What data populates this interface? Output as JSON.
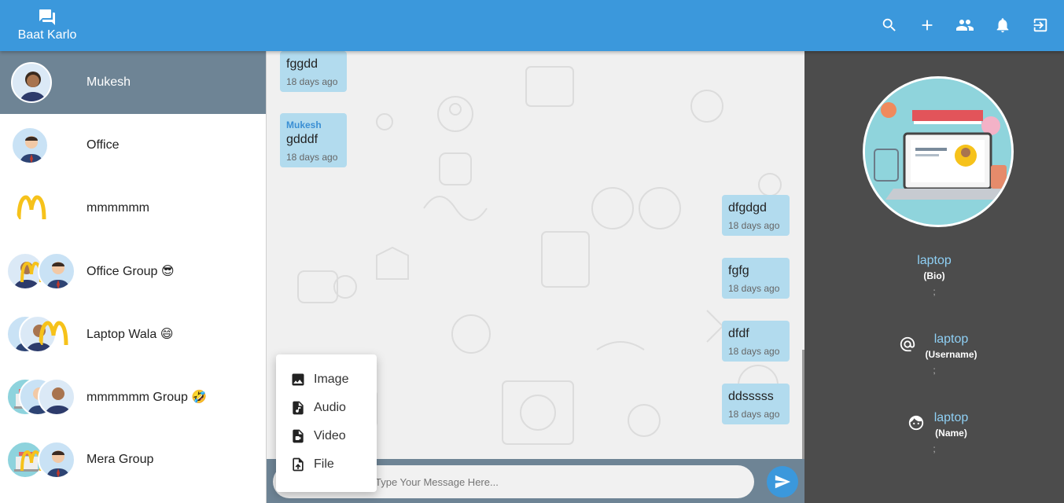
{
  "app": {
    "name": "Baat Karlo"
  },
  "topbar": {
    "icons": [
      "search-icon",
      "add-icon",
      "people-icon",
      "bell-icon",
      "logout-icon"
    ]
  },
  "sidebar": {
    "items": [
      {
        "label": "Mukesh",
        "active": true
      },
      {
        "label": "Office"
      },
      {
        "label": "mmmmmm"
      },
      {
        "label": "Office Group 😎"
      },
      {
        "label": "Laptop Wala 😄"
      },
      {
        "label": "mmmmmm Group 🤣"
      },
      {
        "label": "Mera Group"
      }
    ]
  },
  "chat": {
    "messages": [
      {
        "side": "left",
        "text": "fggdd",
        "time": "18 days ago"
      },
      {
        "side": "left",
        "sender": "Mukesh",
        "text": "gdddf",
        "time": "18 days ago"
      },
      {
        "side": "right",
        "text": "dfgdgd",
        "time": "18 days ago"
      },
      {
        "side": "right",
        "text": "fgfg",
        "time": "18 days ago"
      },
      {
        "side": "right",
        "text": "dfdf",
        "time": "18 days ago"
      },
      {
        "side": "right",
        "text": "ddsssss",
        "time": "18 days ago"
      }
    ],
    "input": {
      "placeholder": "Type Your Message Here..."
    }
  },
  "attach_menu": {
    "items": [
      {
        "label": "Image",
        "icon": "image-icon"
      },
      {
        "label": "Audio",
        "icon": "audio-file-icon"
      },
      {
        "label": "Video",
        "icon": "video-file-icon"
      },
      {
        "label": "File",
        "icon": "upload-file-icon"
      }
    ]
  },
  "profile": {
    "bio": {
      "value": "laptop",
      "caption": "(Bio)",
      "extra": ";"
    },
    "username": {
      "value": "laptop",
      "caption": "(Username)",
      "extra": ";"
    },
    "name": {
      "value": "laptop",
      "caption": "(Name)",
      "extra": ";"
    }
  },
  "colors": {
    "primary": "#3b98dc",
    "active_row": "#6e8495",
    "bubble": "#b2dbee",
    "profile_bg": "#4c4c4c"
  }
}
